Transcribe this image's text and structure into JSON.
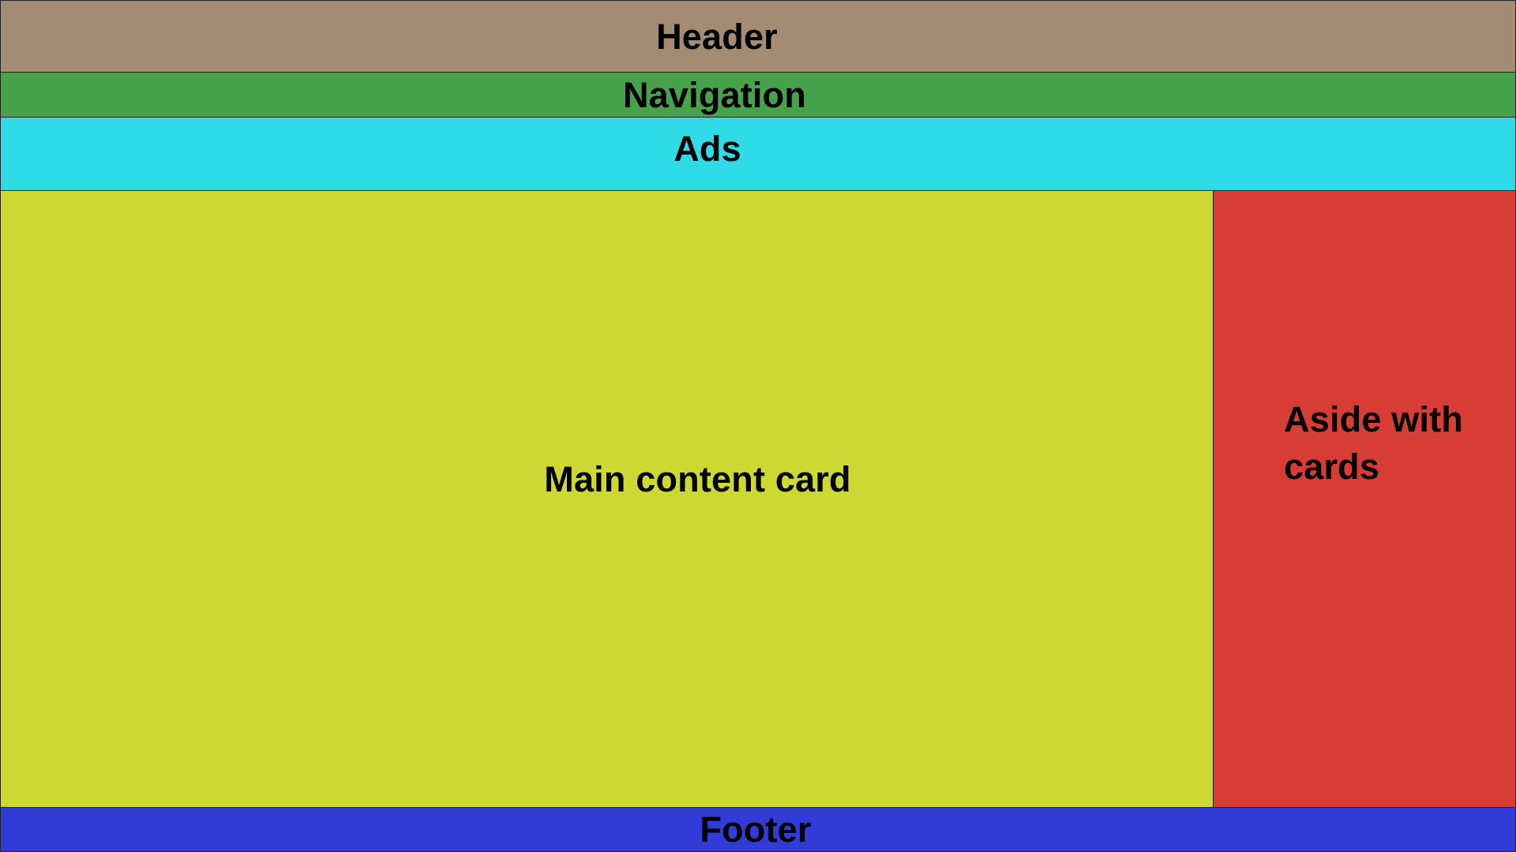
{
  "header": {
    "label": "Header",
    "color": "#A48B74"
  },
  "navigation": {
    "label": "Navigation",
    "color": "#47A24C"
  },
  "ads": {
    "label": "Ads",
    "color": "#2FDBE6"
  },
  "main": {
    "label": "Main content card",
    "color": "#CDD932"
  },
  "aside": {
    "label": "Aside with cards",
    "color": "#D83D35"
  },
  "footer": {
    "label": "Footer",
    "color": "#313CD7"
  }
}
